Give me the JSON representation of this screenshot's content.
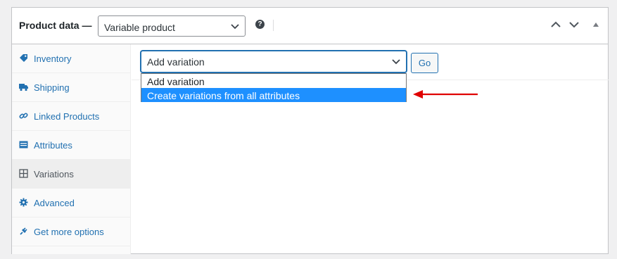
{
  "header": {
    "title": "Product data —",
    "product_type": "Variable product",
    "help": "?"
  },
  "sidebar": {
    "items": [
      {
        "label": "Inventory",
        "icon": "tag-icon"
      },
      {
        "label": "Shipping",
        "icon": "truck-icon"
      },
      {
        "label": "Linked Products",
        "icon": "link-icon"
      },
      {
        "label": "Attributes",
        "icon": "list-icon"
      },
      {
        "label": "Variations",
        "icon": "grid-icon",
        "active": true
      },
      {
        "label": "Advanced",
        "icon": "gear-icon"
      },
      {
        "label": "Get more options",
        "icon": "plugin-icon"
      }
    ]
  },
  "variations": {
    "select_value": "Add variation",
    "go_label": "Go",
    "options": [
      {
        "label": "Add variation"
      },
      {
        "label": "Create variations from all attributes",
        "highlighted": true
      }
    ]
  },
  "colors": {
    "accent": "#2271b1",
    "highlight": "#1e90ff",
    "annotation_arrow": "#e00000"
  }
}
